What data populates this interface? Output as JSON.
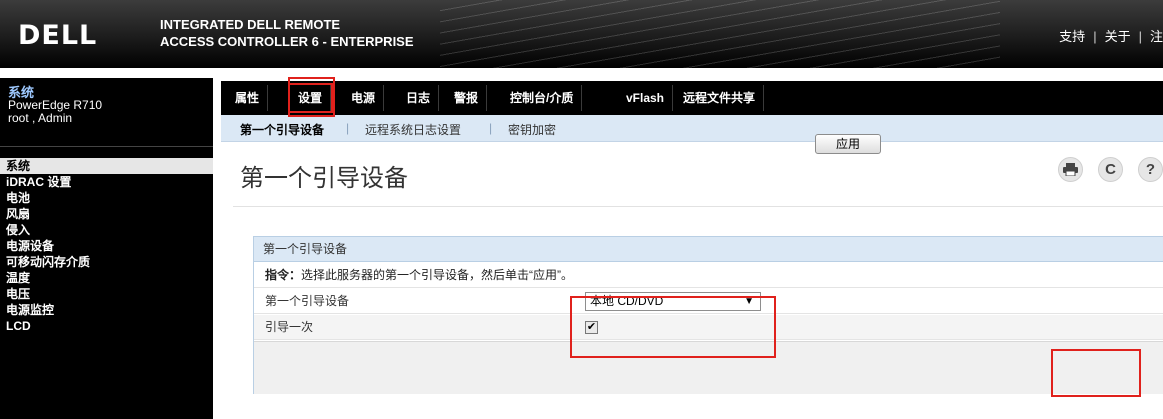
{
  "header": {
    "logo": "DELL",
    "product_line1": "INTEGRATED DELL REMOTE",
    "product_line2": "ACCESS CONTROLLER 6 - ENTERPRISE",
    "links": [
      "支持",
      "关于",
      "注"
    ]
  },
  "sidebar": {
    "system_title": "系统",
    "model": "PowerEdge R710",
    "user": "root , Admin",
    "items": [
      {
        "label": "系统",
        "active": true
      },
      {
        "label": "iDRAC 设置"
      },
      {
        "label": "电池"
      },
      {
        "label": "风扇"
      },
      {
        "label": "侵入"
      },
      {
        "label": "电源设备"
      },
      {
        "label": "可移动闪存介质"
      },
      {
        "label": "温度"
      },
      {
        "label": "电压"
      },
      {
        "label": "电源监控"
      },
      {
        "label": "LCD"
      }
    ]
  },
  "tabs": [
    {
      "label": "属性"
    },
    {
      "label": "设置",
      "active": true
    },
    {
      "label": "电源"
    },
    {
      "label": "日志"
    },
    {
      "label": "警报"
    },
    {
      "label": "控制台/介质"
    },
    {
      "label": "vFlash"
    },
    {
      "label": "远程文件共享"
    }
  ],
  "subtabs": [
    {
      "label": "第一个引导设备",
      "active": true
    },
    {
      "label": "远程系统日志设置"
    },
    {
      "label": "密钥加密"
    }
  ],
  "page": {
    "title": "第一个引导设备",
    "toolbar_icons": [
      "print-icon",
      "refresh-icon",
      "help-icon"
    ]
  },
  "panel": {
    "header": "第一个引导设备",
    "instruction_label": "指令：",
    "instruction_text": "选择此服务器的第一个引导设备，然后单击“应用”。",
    "rows": [
      {
        "label": "第一个引导设备",
        "value": "本地 CD/DVD"
      },
      {
        "label": "引导一次",
        "checked": true
      }
    ],
    "apply_label": "应用"
  },
  "colors": {
    "highlight": "#e0211c",
    "subnav_bg": "#dbe8f5",
    "sidebar_bg": "#000000"
  }
}
